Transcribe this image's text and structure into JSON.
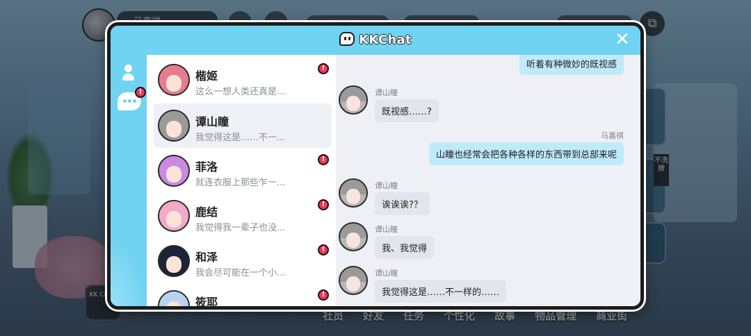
{
  "background": {
    "player_name": "马嘉祺",
    "side_label": "不洗牌",
    "chat_badge": "KK CHAT",
    "bottom_nav": [
      "社员",
      "好友",
      "任务",
      "个性化",
      "故事",
      "物品管理",
      "商业街"
    ]
  },
  "header": {
    "title": "KKChat",
    "close_label": "✕"
  },
  "rail": {
    "contacts_icon": "user-icon",
    "chats_icon": "chat-bubble-icon",
    "chats_alert": "!"
  },
  "contacts": [
    {
      "name": "楷姬",
      "preview": "这么一想人类还真是...",
      "alert": "!",
      "selected": false,
      "hair": "#e97b8e"
    },
    {
      "name": "谭山瞳",
      "preview": "我觉得这是……不一...",
      "alert": "",
      "selected": true,
      "hair": "#9a9a9a"
    },
    {
      "name": "菲洛",
      "preview": "就连衣服上那些乍一...",
      "alert": "!",
      "selected": false,
      "hair": "#c98ae0"
    },
    {
      "name": "鹿结",
      "preview": "我觉得我一辈子也没...",
      "alert": "!",
      "selected": false,
      "hair": "#f3a9c9"
    },
    {
      "name": "和泽",
      "preview": "我会尽可能在一个小...",
      "alert": "!",
      "selected": false,
      "hair": "#1e2438"
    },
    {
      "name": "筱耶",
      "preview": "",
      "alert": "!",
      "selected": false,
      "hair": "#b9d2ee"
    }
  ],
  "messages": [
    {
      "from": "me",
      "sender": "",
      "text": "听着有种微妙的既视感"
    },
    {
      "from": "other",
      "sender": "谭山瞳",
      "text": "既视感……?"
    },
    {
      "from": "me",
      "sender": "马嘉祺",
      "text": "山瞳也经常会把各种各样的东西带到总部来呢"
    },
    {
      "from": "other",
      "sender": "谭山瞳",
      "text": "诶诶诶?？"
    },
    {
      "from": "other",
      "sender": "谭山瞳",
      "text": "我、我觉得"
    },
    {
      "from": "other",
      "sender": "谭山瞳",
      "text": "我觉得这是……不一样的……"
    }
  ],
  "colors": {
    "accent": "#6fd3f1",
    "alert": "#e23b5a",
    "my_bubble": "#bfeafa",
    "their_bubble": "#e3e5ec"
  }
}
